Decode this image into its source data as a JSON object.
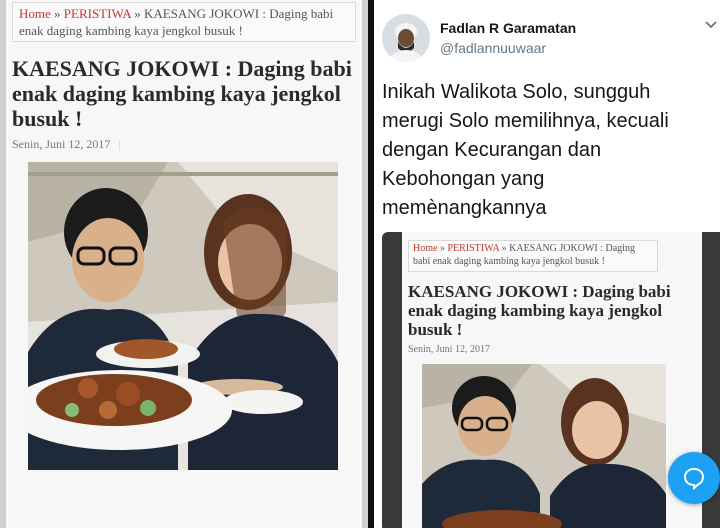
{
  "article": {
    "breadcrumb": {
      "home": "Home",
      "sep1": " » ",
      "section": "PERISTIWA",
      "sep2": " » ",
      "current": "KAESANG JOKOWI : Daging babi enak daging kambing kaya jengkol busuk !"
    },
    "title": "KAESANG JOKOWI : Daging babi enak daging kambing kaya jengkol busuk !",
    "date": "Senin, Juni 12, 2017",
    "date_sep": "|"
  },
  "tweet": {
    "name": "Fadlan R Garamatan",
    "handle": "@fadlannuuwaar",
    "text": "Inikah Walikota Solo, sungguh merugi Solo memilihnya, kecuali dengan Kecurangan dan Kebohongan yang memènangkannya"
  },
  "embedded_article": {
    "breadcrumb": {
      "home": "Home",
      "sep1": " » ",
      "section": "PERISTIWA",
      "sep2": " » ",
      "current": "KAESANG JOKOWI : Daging babi enak daging kambing kaya jengkol busuk !"
    },
    "title": "KAESANG JOKOWI : Daging babi enak daging kambing kaya jengkol busuk !",
    "date": "Senin, Juni 12, 2017"
  },
  "icons": {
    "chevron": "chevron-down-icon",
    "fab": "speech-bubble-icon"
  },
  "colors": {
    "link": "#c0392b",
    "twitter_blue": "#1da1f2"
  }
}
